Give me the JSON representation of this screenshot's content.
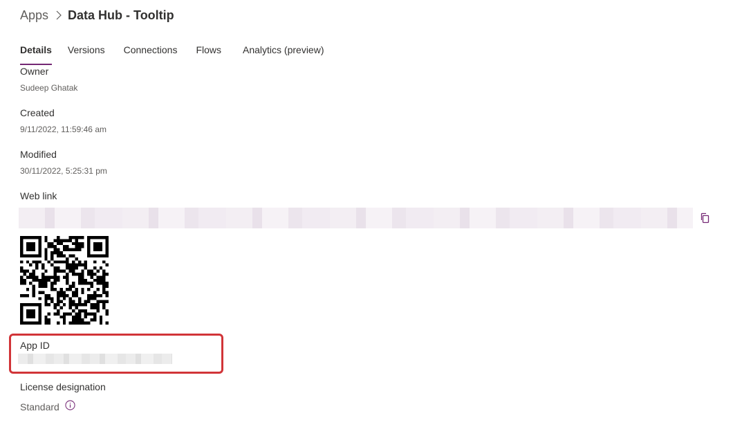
{
  "breadcrumb": {
    "root": "Apps",
    "separator_icon": "chevron-right-icon",
    "current": "Data Hub - Tooltip"
  },
  "tabs": [
    {
      "label": "Details",
      "active": true
    },
    {
      "label": "Versions",
      "active": false
    },
    {
      "label": "Connections",
      "active": false
    },
    {
      "label": "Flows",
      "active": false
    },
    {
      "label": "Analytics (preview)",
      "active": false
    }
  ],
  "details": {
    "owner": {
      "label": "Owner",
      "value": "Sudeep Ghatak"
    },
    "created": {
      "label": "Created",
      "value": "9/11/2022, 11:59:46 am"
    },
    "modified": {
      "label": "Modified",
      "value": "30/11/2022, 5:25:31 pm"
    },
    "web_link": {
      "label": "Web link",
      "copy_icon": "copy-icon"
    },
    "app_id": {
      "label": "App ID"
    },
    "license": {
      "label": "License designation",
      "value": "Standard",
      "info_icon": "info-icon"
    }
  },
  "colors": {
    "accent": "#742774",
    "highlight": "#d13438",
    "text": "#323130",
    "secondary_text": "#605e5c"
  }
}
